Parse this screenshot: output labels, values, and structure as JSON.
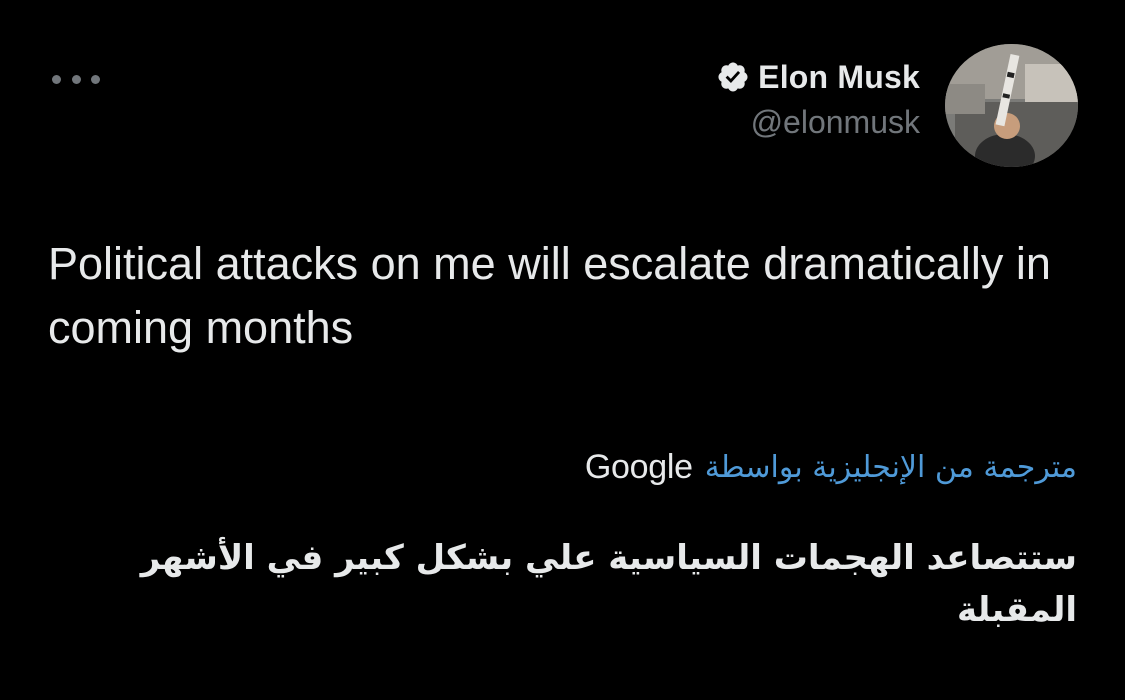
{
  "header": {
    "display_name": "Elon Musk",
    "handle": "@elonmusk",
    "verified": true,
    "more_icon": "more-horizontal-icon",
    "verified_icon": "verified-badge-icon"
  },
  "tweet": {
    "text": "Political attacks on me will escalate dramatically in coming months"
  },
  "translation": {
    "label": "مترجمة من الإنجليزية بواسطة",
    "provider": "Google",
    "text": "ستتصاعد الهجمات السياسية علي بشكل كبير في الأشهر المقبلة"
  },
  "colors": {
    "background": "#000000",
    "primary_text": "#e7e9ea",
    "secondary_text": "#71767b",
    "link": "#4f9ad8"
  }
}
